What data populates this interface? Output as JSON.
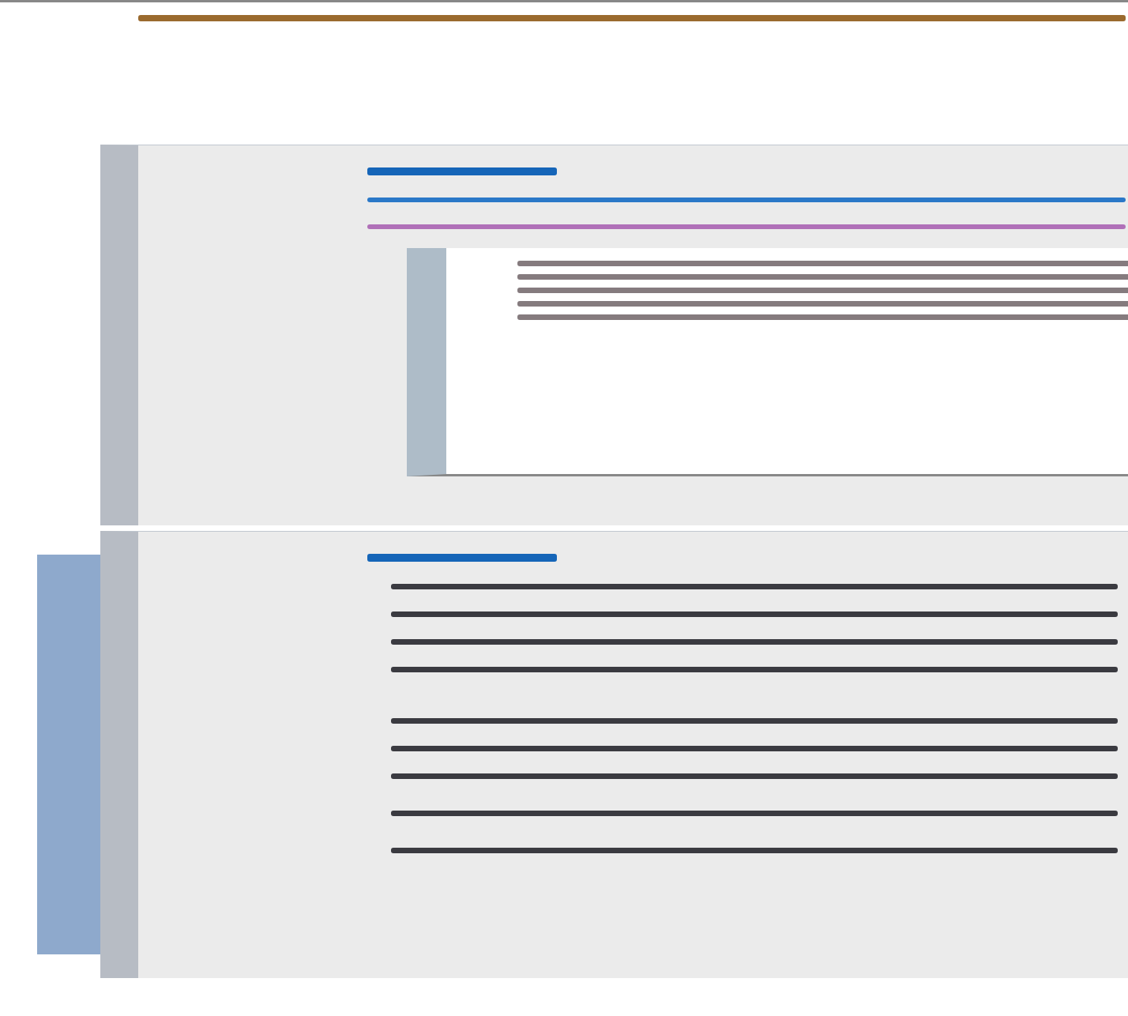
{
  "header": {
    "lines": [
      {
        "kind": "title",
        "color": "#9a6a2e"
      }
    ]
  },
  "panels": [
    {
      "accent": false,
      "lines": [
        {
          "kind": "heading",
          "color": "#1565b8"
        },
        {
          "kind": "link",
          "color": "#2a78c8"
        },
        {
          "kind": "link",
          "color": "#b070b8"
        }
      ],
      "inset": {
        "lines": [
          {
            "kind": "body",
            "color": "#857b7e"
          },
          {
            "kind": "body",
            "color": "#857b7e"
          },
          {
            "kind": "body",
            "color": "#857b7e"
          },
          {
            "kind": "body",
            "color": "#857b7e"
          },
          {
            "kind": "body",
            "color": "#857b7e"
          }
        ]
      }
    },
    {
      "accent": true,
      "lines": [
        {
          "kind": "heading",
          "color": "#1565b8"
        },
        {
          "kind": "body",
          "color": "#3a3a40"
        },
        {
          "kind": "body",
          "color": "#3a3a40"
        },
        {
          "kind": "body",
          "color": "#3a3a40"
        },
        {
          "kind": "body",
          "color": "#3a3a40"
        },
        {
          "kind": "gap",
          "color": "#3a3a40"
        },
        {
          "kind": "body",
          "color": "#3a3a40"
        },
        {
          "kind": "body",
          "color": "#3a3a40"
        },
        {
          "kind": "wide",
          "color": "#3a3a40"
        },
        {
          "kind": "wide",
          "color": "#3a3a40"
        }
      ]
    }
  ]
}
